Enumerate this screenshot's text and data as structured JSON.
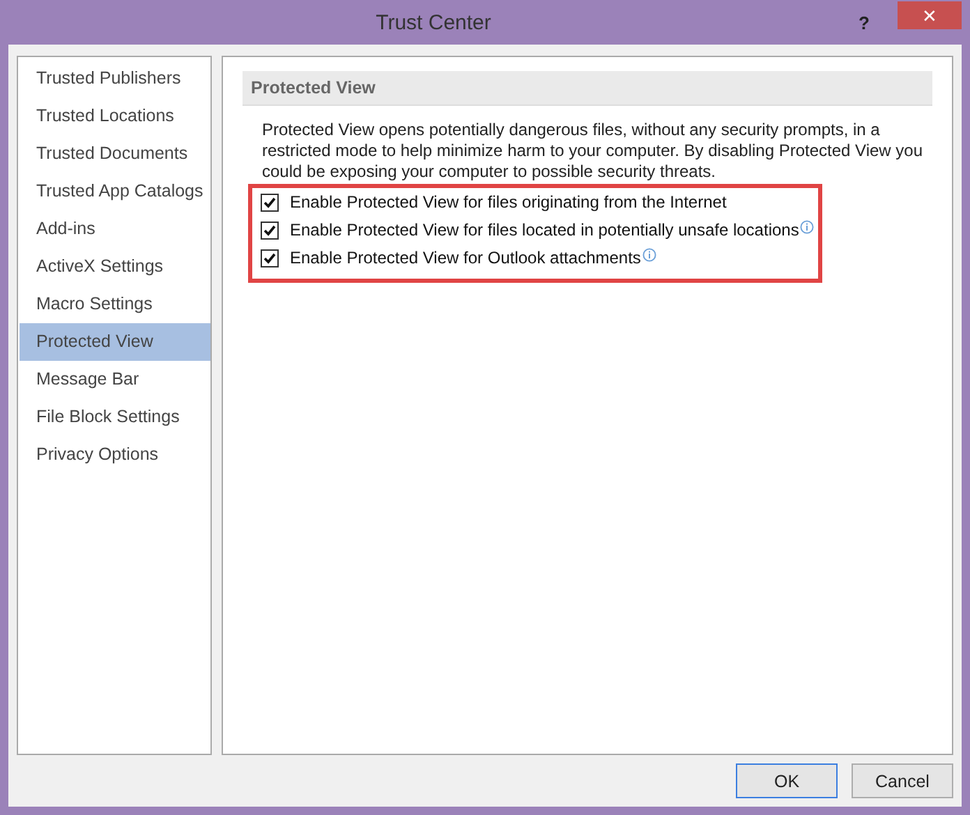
{
  "window": {
    "title": "Trust Center",
    "help": "?",
    "close": "✕"
  },
  "sidebar": {
    "items": [
      {
        "label": "Trusted Publishers",
        "selected": false
      },
      {
        "label": "Trusted Locations",
        "selected": false
      },
      {
        "label": "Trusted Documents",
        "selected": false
      },
      {
        "label": "Trusted App Catalogs",
        "selected": false
      },
      {
        "label": "Add-ins",
        "selected": false
      },
      {
        "label": "ActiveX Settings",
        "selected": false
      },
      {
        "label": "Macro Settings",
        "selected": false
      },
      {
        "label": "Protected View",
        "selected": true
      },
      {
        "label": "Message Bar",
        "selected": false
      },
      {
        "label": "File Block Settings",
        "selected": false
      },
      {
        "label": "Privacy Options",
        "selected": false
      }
    ]
  },
  "section": {
    "heading": "Protected View",
    "description": "Protected View opens potentially dangerous files, without any security prompts, in a restricted mode to help minimize harm to your computer. By disabling Protected View you could be exposing your computer to possible security threats.",
    "highlighted": true,
    "options": [
      {
        "label": "Enable Protected View for files originating from the Internet",
        "checked": true,
        "info": false
      },
      {
        "label": "Enable Protected View for files located in potentially unsafe locations",
        "checked": true,
        "info": true
      },
      {
        "label": "Enable Protected View for Outlook attachments",
        "checked": true,
        "info": true
      }
    ]
  },
  "buttons": [
    {
      "label": "OK",
      "selected": true
    },
    {
      "label": "Cancel",
      "selected": false
    }
  ]
}
